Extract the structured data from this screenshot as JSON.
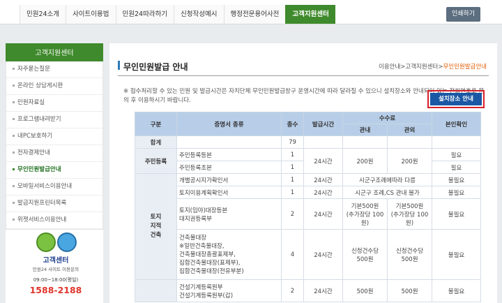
{
  "nav": {
    "items": [
      "민원24소개",
      "사이트이용법",
      "민원24따라하기",
      "신청작성예시",
      "행정전문용어사전",
      "고객지원센터"
    ],
    "active_index": 5,
    "print_label": "인쇄하기"
  },
  "sidebar": {
    "title": "고객지원센터",
    "items": [
      "자주묻는질문",
      "온라인 상담게시판",
      "민원자료실",
      "프로그램내려받기",
      "내PC보호하기",
      "전자결제안내",
      "무인민원발급안내",
      "모바일서비스이용안내",
      "발급지원프린터목록",
      "위젯서비스이용안내"
    ],
    "active_index": 6
  },
  "promo": {
    "title": "고객센터",
    "subtitle": "민원24 사이트 이용문의",
    "hours": "09:00~18:00(평일)",
    "phone": "1588-2188"
  },
  "page": {
    "title": "무인민원발급 안내",
    "breadcrumb": [
      "이용안내",
      "고객지원센터",
      "무인민원발급안내"
    ],
    "notice": "※ 접수처리할 수 있는 민원 및 발급시간은 자치단체 무인민원발급창구 운영시간에 따라 달라질 수 있으니 설치장소와 안내되어 있는 전화번호로 문의 후 이용하시기 바랍니다.",
    "locate_button": "설치장소 안내"
  },
  "table": {
    "headers": {
      "category": "구분",
      "doc_type": "증명서 종류",
      "count": "종수",
      "hours": "발급시간",
      "fee": "수수료",
      "fee_counter": "관내",
      "fee_outside": "관외",
      "id_check": "본인확인"
    },
    "total": {
      "label": "합계",
      "count": "79"
    },
    "groups": [
      {
        "name": "주민등록",
        "rows": [
          {
            "doc": "주민등록등본",
            "count": "1",
            "hours": "24시간",
            "fee_in": "200원",
            "fee_out": "200원",
            "id": "필요"
          },
          {
            "doc": "주민등록초본",
            "count": "1",
            "hours": "",
            "fee_in": "",
            "fee_out": "",
            "id": "필요"
          }
        ]
      },
      {
        "name": "토지 지적 건축",
        "rows": [
          {
            "doc": "개별공시지가확인서",
            "count": "1",
            "hours": "24시간",
            "fee_in": "시군구조례에따라 다름",
            "fee_out": "",
            "id": "불필요"
          },
          {
            "doc": "토지이용계획확인서",
            "count": "1",
            "hours": "24시간",
            "fee_in": "시군구 조례,CS 관내 불가",
            "fee_out": "",
            "id": "불필요"
          },
          {
            "doc": "토지(임야)대장등본\n대지권등록부",
            "count": "2",
            "hours": "24시간",
            "fee_in": "기본500원\n(추가장당 100원)",
            "fee_out": "기본500원\n(추가장당 100원)",
            "id": "불필요"
          },
          {
            "doc": "건축물대장\n※일반건축물대장,\n건축물대장총괄표제부,\n집합건축물대장(표제부),\n집합건축물대장(전유부분)",
            "count": "4",
            "hours": "24시간",
            "fee_in": "신청건수당\n500원",
            "fee_out": "신청건수당\n500원",
            "id": "불필요"
          }
        ]
      },
      {
        "name": "",
        "rows": [
          {
            "doc": "건설기계등록원부\n건설기계등록원부(갑)",
            "count": "2",
            "hours": "24시간",
            "fee_in": "500원",
            "fee_out": "500원",
            "id": "불필요"
          }
        ]
      }
    ]
  }
}
